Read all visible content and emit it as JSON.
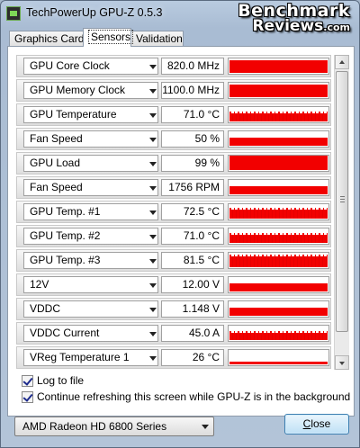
{
  "window": {
    "title": "TechPowerUp GPU-Z 0.5.3"
  },
  "logo": {
    "line1": "Benchmark",
    "line2": "Reviews",
    "suffix": ".com"
  },
  "tabs": [
    {
      "label": "Graphics Card",
      "active": false
    },
    {
      "label": "Sensors",
      "active": true
    },
    {
      "label": "Validation",
      "active": false
    }
  ],
  "sensors": [
    {
      "name": "GPU Core Clock",
      "value": "820.0 MHz",
      "fill_fraction": 0.85,
      "graph_style": "solid"
    },
    {
      "name": "GPU Memory Clock",
      "value": "1100.0 MHz",
      "fill_fraction": 0.85,
      "graph_style": "solid"
    },
    {
      "name": "GPU Temperature",
      "value": "71.0 °C",
      "fill_fraction": 0.55,
      "graph_style": "noisy"
    },
    {
      "name": "Fan Speed",
      "value": "50 %",
      "fill_fraction": 0.5,
      "graph_style": "solid"
    },
    {
      "name": "GPU Load",
      "value": "99 %",
      "fill_fraction": 0.95,
      "graph_style": "solid"
    },
    {
      "name": "Fan Speed",
      "value": "1756 RPM",
      "fill_fraction": 0.5,
      "graph_style": "solid"
    },
    {
      "name": "GPU Temp. #1",
      "value": "72.5 °C",
      "fill_fraction": 0.6,
      "graph_style": "noisy"
    },
    {
      "name": "GPU Temp. #2",
      "value": "71.0 °C",
      "fill_fraction": 0.55,
      "graph_style": "noisy"
    },
    {
      "name": "GPU Temp. #3",
      "value": "81.5 °C",
      "fill_fraction": 0.7,
      "graph_style": "noisy"
    },
    {
      "name": "12V",
      "value": "12.00 V",
      "fill_fraction": 0.55,
      "graph_style": "solid"
    },
    {
      "name": "VDDC",
      "value": "1.148 V",
      "fill_fraction": 0.55,
      "graph_style": "solid"
    },
    {
      "name": "VDDC Current",
      "value": "45.0 A",
      "fill_fraction": 0.45,
      "graph_style": "noisy"
    },
    {
      "name": "VReg Temperature 1",
      "value": "26 °C",
      "fill_fraction": 0.15,
      "graph_style": "solid"
    }
  ],
  "options": {
    "log_to_file": {
      "label": "Log to file",
      "checked": true
    },
    "continue_refresh": {
      "label": "Continue refreshing this screen while GPU-Z is in the background",
      "checked": true
    }
  },
  "gpu_select": {
    "value": "AMD Radeon HD 6800 Series"
  },
  "close_button": {
    "label_underlined": "C",
    "label_rest": "lose"
  },
  "colors": {
    "graph": "#f20000",
    "window_frame": "#a9bcd3"
  }
}
